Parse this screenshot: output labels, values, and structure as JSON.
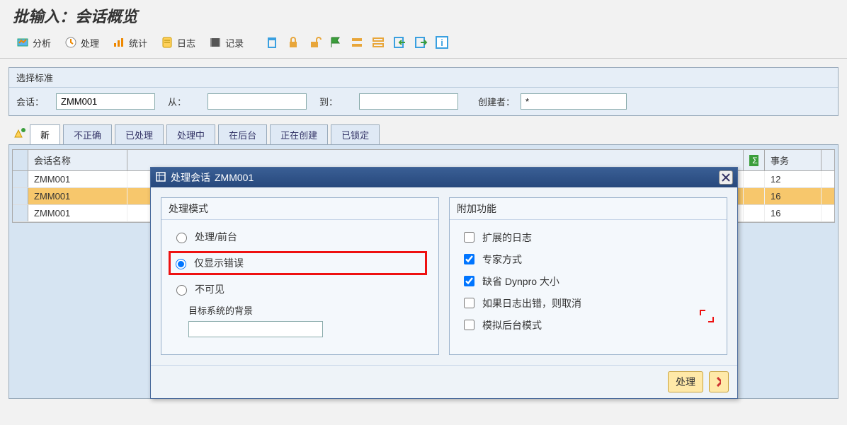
{
  "page_title": "批输入：会话概览",
  "toolbar": {
    "analyze": "分析",
    "process": "处理",
    "stats": "统计",
    "log": "日志",
    "record": "记录"
  },
  "criteria": {
    "panel_title": "选择标准",
    "session_label": "会话：",
    "session_value": "ZMM001",
    "from_label": "从：",
    "from_value": "",
    "to_label": "到：",
    "to_value": "",
    "creator_label": "创建者：",
    "creator_value": "*"
  },
  "tabs": {
    "t0": "新",
    "t1": "不正确",
    "t2": "已处理",
    "t3": "处理中",
    "t4": "在后台",
    "t5": "正在创建",
    "t6": "已锁定"
  },
  "grid": {
    "col_session": "会话名称",
    "col_trans": "事务",
    "rows": [
      {
        "name": "ZMM001",
        "trans": "12",
        "sel": false
      },
      {
        "name": "ZMM001",
        "trans": "16",
        "sel": true
      },
      {
        "name": "ZMM001",
        "trans": "16",
        "sel": false
      }
    ]
  },
  "dialog": {
    "title_prefix": "处理会话",
    "title_session": "ZMM001",
    "group_mode": "处理模式",
    "radio_fg": "处理/前台",
    "radio_err": "仅显示错误",
    "radio_inv": "不可见",
    "bg_label": "目标系统的背景",
    "bg_value": "",
    "group_addon": "附加功能",
    "chk_extlog": "扩展的日志",
    "chk_expert": "专家方式",
    "chk_dynpro": "缺省 Dynpro 大小",
    "chk_cancel": "如果日志出错，则取消",
    "chk_sim": "模拟后台模式",
    "chk_extlog_v": false,
    "chk_expert_v": true,
    "chk_dynpro_v": true,
    "chk_cancel_v": false,
    "chk_sim_v": false,
    "btn_process": "处理"
  }
}
